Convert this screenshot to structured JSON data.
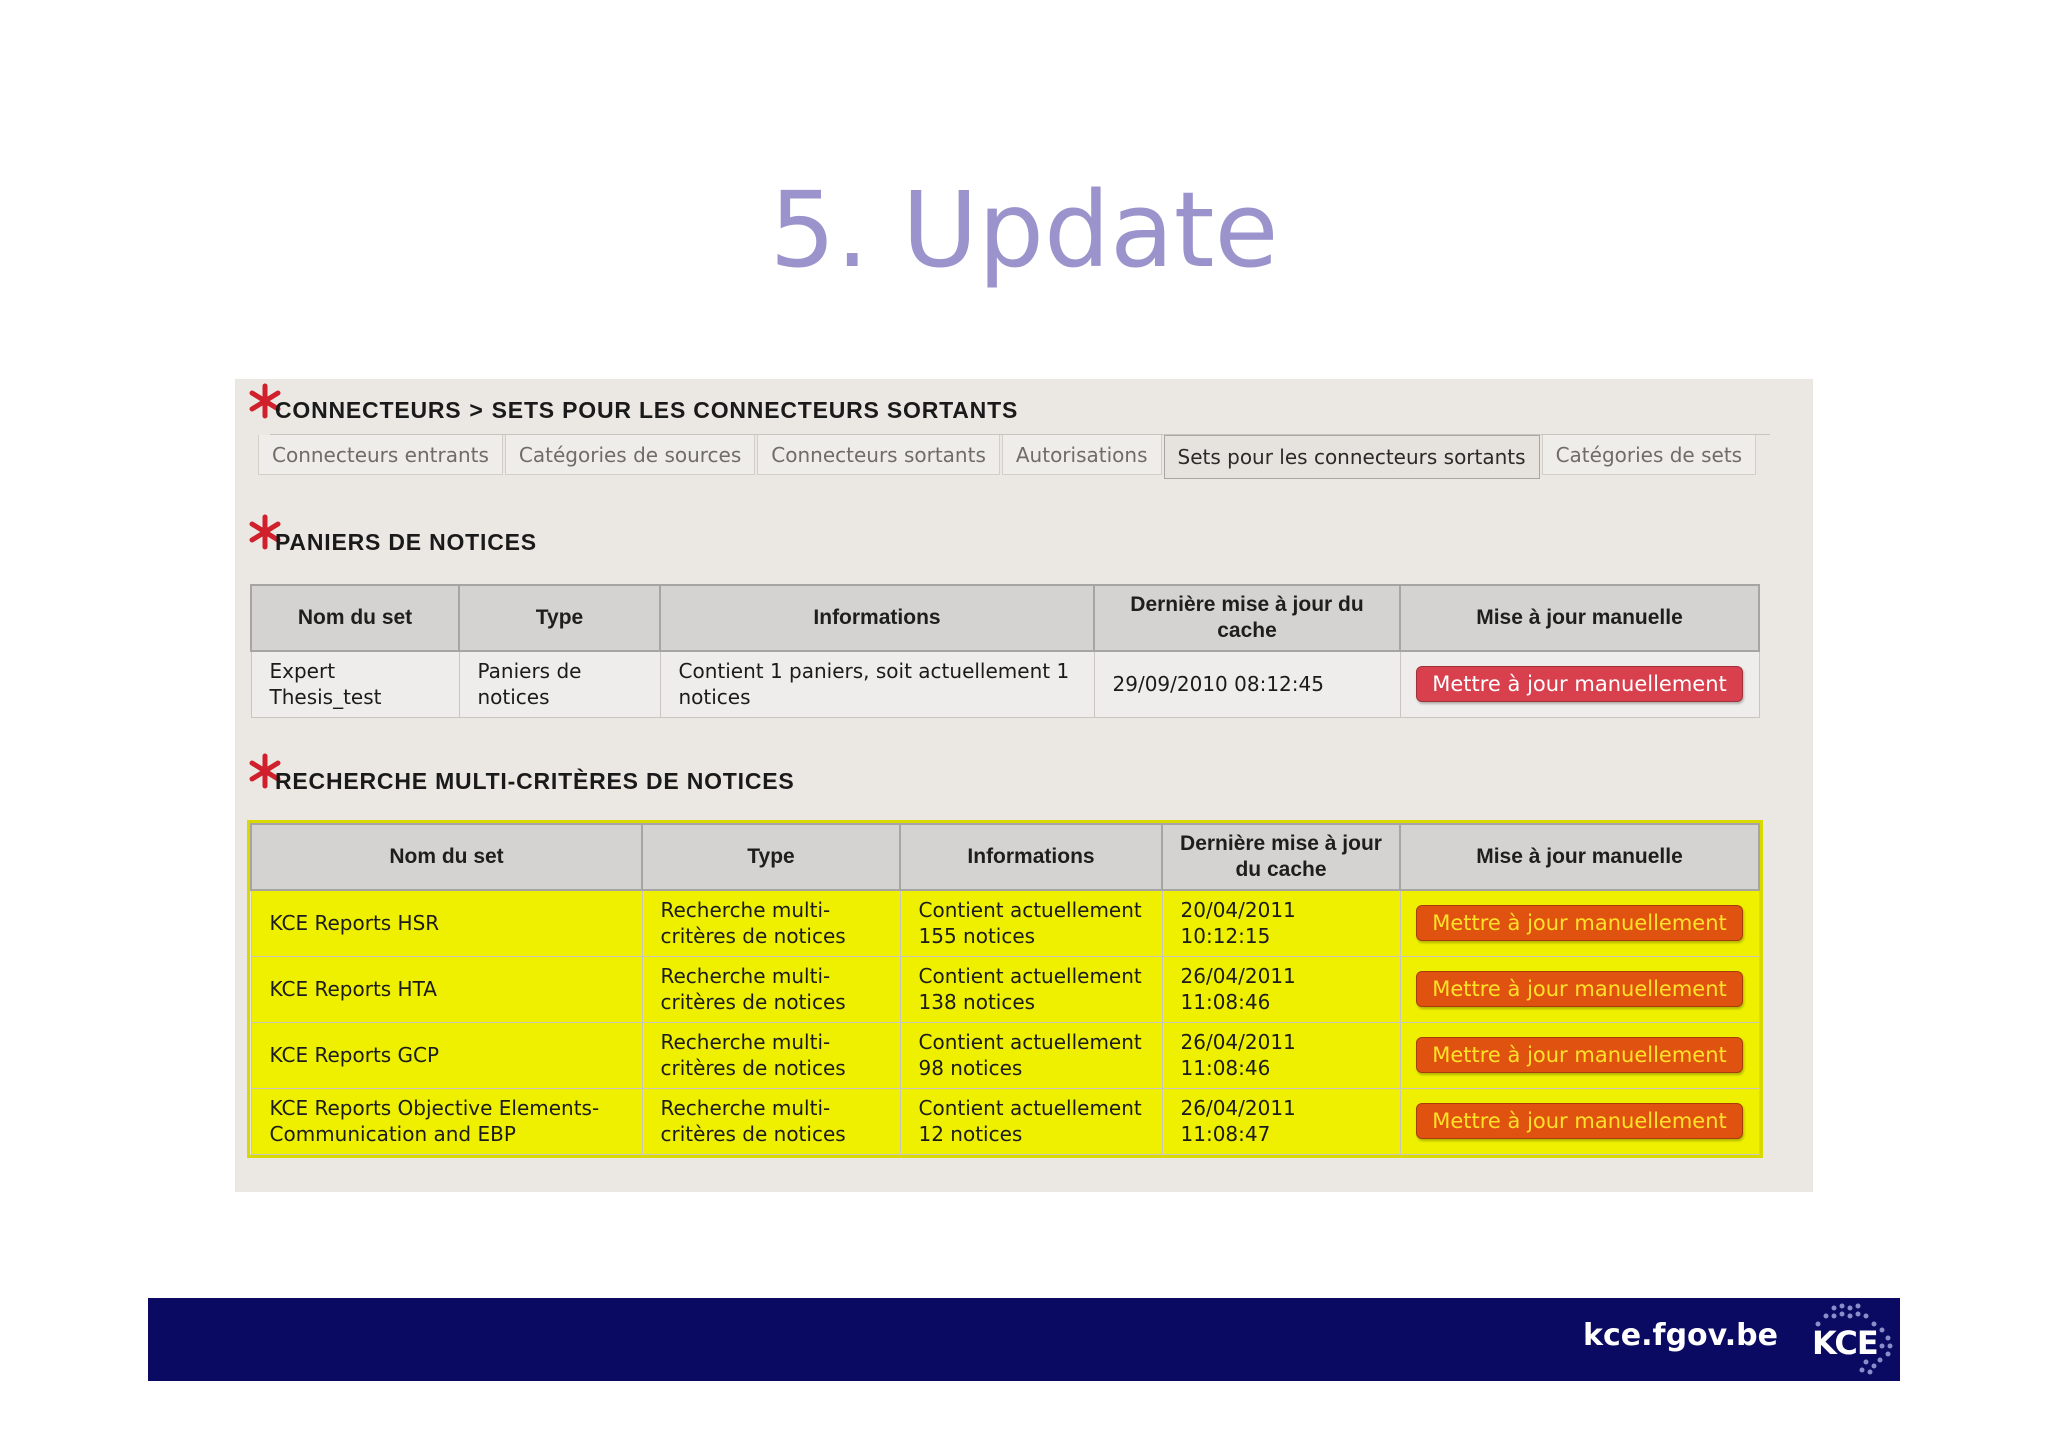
{
  "slide": {
    "title": "5. Update"
  },
  "breadcrumb": {
    "part1": "CONNECTEURS",
    "separator": ">",
    "part2": "SETS POUR LES CONNECTEURS SORTANTS"
  },
  "tabs": [
    {
      "label": "Connecteurs entrants",
      "active": false
    },
    {
      "label": "Catégories de sources",
      "active": false
    },
    {
      "label": "Connecteurs sortants",
      "active": false
    },
    {
      "label": "Autorisations",
      "active": false
    },
    {
      "label": "Sets pour les connecteurs sortants",
      "active": true
    },
    {
      "label": "Catégories de sets",
      "active": false
    }
  ],
  "paniers": {
    "title": "PANIERS DE NOTICES",
    "headers": [
      "Nom du set",
      "Type",
      "Informations",
      "Dernière mise à jour du cache",
      "Mise à jour manuelle"
    ],
    "rows": [
      {
        "name": "Expert Thesis_test",
        "type": "Paniers de notices",
        "info": "Contient 1 paniers, soit actuellement 1 notices",
        "updated": "29/09/2010 08:12:45",
        "button": "Mettre à jour manuellement"
      }
    ]
  },
  "recherche": {
    "title": "RECHERCHE MULTI-CRITÈRES DE NOTICES",
    "headers": [
      "Nom du set",
      "Type",
      "Informations",
      "Dernière mise à jour du cache",
      "Mise à jour manuelle"
    ],
    "rows": [
      {
        "name": "KCE Reports HSR",
        "type": "Recherche multi-critères de notices",
        "info": "Contient actuellement 155 notices",
        "updated": "20/04/2011 10:12:15",
        "button": "Mettre à jour manuellement"
      },
      {
        "name": "KCE Reports HTA",
        "type": "Recherche multi-critères de notices",
        "info": "Contient actuellement 138 notices",
        "updated": "26/04/2011 11:08:46",
        "button": "Mettre à jour manuellement"
      },
      {
        "name": "KCE Reports GCP",
        "type": "Recherche multi-critères de notices",
        "info": "Contient actuellement 98 notices",
        "updated": "26/04/2011 11:08:46",
        "button": "Mettre à jour manuellement"
      },
      {
        "name": "KCE Reports Objective Elements-Communication and EBP",
        "type": "Recherche multi-critères de notices",
        "info": "Contient actuellement 12 notices",
        "updated": "26/04/2011 11:08:47",
        "button": "Mettre à jour manuellement"
      }
    ]
  },
  "footer": {
    "url": "kce.fgov.be",
    "logo_text": "KCE"
  },
  "colors": {
    "title": "#9b93cc",
    "footer_bg": "#0a0a63",
    "highlight": "#eef000",
    "star": "#d0202c",
    "button_red": "#d8404e",
    "button_orange": "#e05210"
  },
  "icons": {
    "section_marker": "red-asterisk-icon"
  }
}
